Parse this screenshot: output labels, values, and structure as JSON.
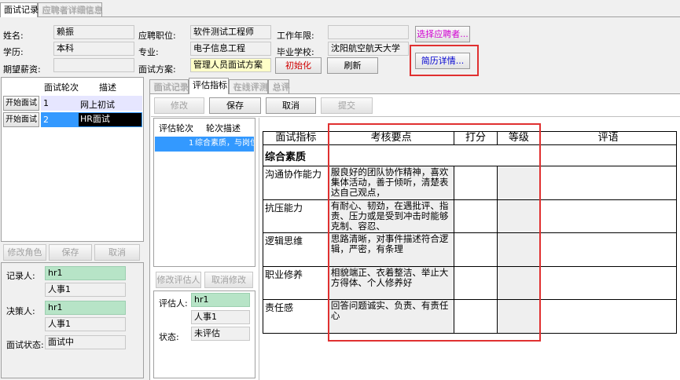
{
  "tabs_top": [
    {
      "label": "面试记录"
    },
    {
      "label": "应聘者详细信息"
    }
  ],
  "info": {
    "name_label": "姓名:",
    "name_value": "赖振",
    "edu_label": "学历:",
    "edu_value": "本科",
    "salary_label": "期望薪资:",
    "salary_value": "",
    "position_label": "应聘职位:",
    "position_value": "软件测试工程师",
    "major_label": "专业:",
    "major_value": "电子信息工程",
    "plan_label": "面试方案:",
    "plan_value": "管理人员面试方案",
    "years_label": "工作年限:",
    "years_value": "",
    "school_label": "毕业学校:",
    "school_value": "沈阳航空航天大学",
    "init_button": "初始化",
    "refresh_button": "刷新",
    "select_applicant_button": "选择应聘者...",
    "resume_button": "简历详情..."
  },
  "rounds": {
    "col_round": "面试轮次",
    "col_desc": "描述",
    "rows": [
      {
        "button": "开始面试",
        "round": "1",
        "desc": "网上初试"
      },
      {
        "button": "开始面试",
        "round": "2",
        "desc": "HR面试"
      }
    ],
    "edit_role_button": "修改角色",
    "save_button": "保存",
    "cancel_button": "取消"
  },
  "people": {
    "recorder_label": "记录人:",
    "recorder_value": "hr1",
    "recorder_name": "人事1",
    "decider_label": "决策人:",
    "decider_value": "hr1",
    "decider_name": "人事1",
    "status_label": "面试状态:",
    "status_value": "面试中"
  },
  "tabs_mid": [
    {
      "label": "面试记录"
    },
    {
      "label": "评估指标"
    },
    {
      "label": "在线评测"
    },
    {
      "label": "总评"
    }
  ],
  "toolbar": {
    "edit": "修改",
    "save": "保存",
    "cancel": "取消",
    "submit": "提交"
  },
  "eval": {
    "col_round": "评估轮次",
    "col_desc": "轮次描述",
    "row_round": "1",
    "row_desc": "综合素质，与岗位",
    "edit_evaluator_button": "修改评估人",
    "cancel_edit_button": "取消修改",
    "evaluator_label": "评估人:",
    "evaluator_value": "hr1",
    "evaluator_name": "人事1",
    "status_label": "状态:",
    "status_value": "未评估"
  },
  "score_table": {
    "headers": [
      "面试指标",
      "考核要点",
      "打分",
      "等级",
      "评语"
    ],
    "section": "综合素质",
    "rows": [
      {
        "indicator": "沟通协作能力",
        "points": "服良好的团队协作精神，喜欢集体活动，善于倾听，清楚表达自己观点，"
      },
      {
        "indicator": "抗压能力",
        "points": "有耐心、韧劲，在遇批评、指责、压力或是受到冲击时能够克制、容忍、"
      },
      {
        "indicator": "逻辑思维",
        "points": "思路清晰，对事件描述符合逻辑，严密，有条理"
      },
      {
        "indicator": "职业修养",
        "points": "相貌端正、衣着整洁、举止大方得体、个人修养好"
      },
      {
        "indicator": "责任感",
        "points": "回答问题诚实、负责、有责任心"
      }
    ]
  },
  "colors": {
    "highlight": "#e03030",
    "selected_row": "#3399ff",
    "green_field": "#b7e4c7"
  }
}
